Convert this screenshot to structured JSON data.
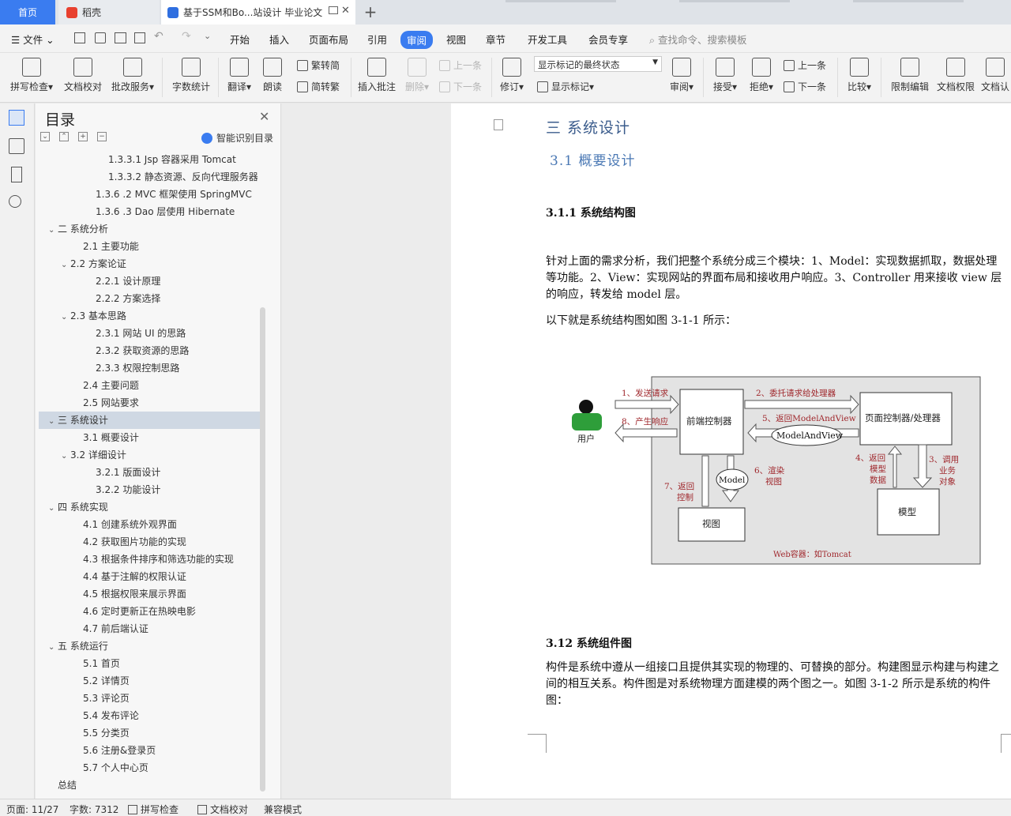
{
  "tabs": {
    "home": "首页",
    "daoke": "稻壳",
    "doc": "基于SSM和Bo...站设计 毕业论文",
    "new_tab": "+"
  },
  "menubar": {
    "file": "文件",
    "items": [
      "开始",
      "插入",
      "页面布局",
      "引用",
      "审阅",
      "视图",
      "章节",
      "开发工具",
      "会员专享"
    ],
    "search": "查找命令、搜索模板"
  },
  "ribbon": {
    "spell_check": "拼写检查",
    "doc_proof": "文档校对",
    "batch_service": "批改服务",
    "word_count": "字数统计",
    "translate": "翻译",
    "read_aloud": "朗读",
    "trad_simp": "繁转简",
    "simp_trad": "简转繁",
    "insert_comment": "插入批注",
    "delete": "删除",
    "prev_comment": "上一条",
    "next_comment": "下一条",
    "revise": "修订",
    "markup_state": "显示标记的最终状态",
    "show_markup": "显示标记",
    "review_pane": "审阅",
    "accept": "接受",
    "reject": "拒绝",
    "prev_change": "上一条",
    "next_change": "下一条",
    "compare": "比较",
    "restrict_edit": "限制编辑",
    "doc_rights": "文档权限",
    "doc_auth": "文档认"
  },
  "toc": {
    "title": "目录",
    "smart": "智能识别目录",
    "items": [
      {
        "text": "1.3.3.1 Jsp 容器采用 Tomcat",
        "indent": 4,
        "chev": ""
      },
      {
        "text": "1.3.3.2 静态资源、反向代理服务器 ...",
        "indent": 4,
        "chev": ""
      },
      {
        "text": "1.3.6 .2 MVC 框架使用 SpringMVC",
        "indent": 3,
        "chev": ""
      },
      {
        "text": "1.3.6 .3 Dao 层使用 Hibernate",
        "indent": 3,
        "chev": ""
      },
      {
        "text": "二 系统分析",
        "indent": 0,
        "chev": "v"
      },
      {
        "text": "2.1 主要功能",
        "indent": 2,
        "chev": ""
      },
      {
        "text": "2.2 方案论证",
        "indent": 1,
        "chev": "v"
      },
      {
        "text": "2.2.1 设计原理",
        "indent": 3,
        "chev": ""
      },
      {
        "text": "2.2.2 方案选择",
        "indent": 3,
        "chev": ""
      },
      {
        "text": "2.3 基本思路",
        "indent": 1,
        "chev": "v"
      },
      {
        "text": "2.3.1 网站 UI 的思路",
        "indent": 3,
        "chev": ""
      },
      {
        "text": "2.3.2 获取资源的思路",
        "indent": 3,
        "chev": ""
      },
      {
        "text": "2.3.3 权限控制思路",
        "indent": 3,
        "chev": ""
      },
      {
        "text": "2.4 主要问题",
        "indent": 2,
        "chev": ""
      },
      {
        "text": "2.5 网站要求",
        "indent": 2,
        "chev": ""
      },
      {
        "text": "三 系统设计",
        "indent": 0,
        "chev": "v",
        "selected": true
      },
      {
        "text": "3.1 概要设计",
        "indent": 2,
        "chev": ""
      },
      {
        "text": "3.2 详细设计",
        "indent": 1,
        "chev": "v"
      },
      {
        "text": "3.2.1 版面设计",
        "indent": 3,
        "chev": ""
      },
      {
        "text": "3.2.2 功能设计",
        "indent": 3,
        "chev": ""
      },
      {
        "text": "四 系统实现",
        "indent": 0,
        "chev": "v"
      },
      {
        "text": "4.1 创建系统外观界面",
        "indent": 2,
        "chev": ""
      },
      {
        "text": "4.2 获取图片功能的实现",
        "indent": 2,
        "chev": ""
      },
      {
        "text": "4.3 根据条件排序和筛选功能的实现",
        "indent": 2,
        "chev": ""
      },
      {
        "text": "4.4 基于注解的权限认证",
        "indent": 2,
        "chev": ""
      },
      {
        "text": "4.5 根据权限来展示界面",
        "indent": 2,
        "chev": ""
      },
      {
        "text": "4.6 定时更新正在热映电影",
        "indent": 2,
        "chev": ""
      },
      {
        "text": "4.7 前后端认证",
        "indent": 2,
        "chev": ""
      },
      {
        "text": "五 系统运行",
        "indent": 0,
        "chev": "v"
      },
      {
        "text": "5.1 首页",
        "indent": 2,
        "chev": ""
      },
      {
        "text": "5.2 详情页",
        "indent": 2,
        "chev": ""
      },
      {
        "text": "5.3 评论页",
        "indent": 2,
        "chev": ""
      },
      {
        "text": "5.4 发布评论",
        "indent": 2,
        "chev": ""
      },
      {
        "text": "5.5 分类页",
        "indent": 2,
        "chev": ""
      },
      {
        "text": "5.6 注册&登录页",
        "indent": 2,
        "chev": ""
      },
      {
        "text": "5.7 个人中心页",
        "indent": 2,
        "chev": ""
      },
      {
        "text": "总结",
        "indent": 0,
        "chev": ""
      }
    ]
  },
  "document": {
    "h1": "三 系统设计",
    "h2": "3.1 概要设计",
    "h311": "3.1.1 系统结构图",
    "p1": "针对上面的需求分析，我们把整个系统分成三个模块：1、Model：实现数据抓取，数据处理等功能。2、View：实现网站的界面布局和接收用户响应。3、Controller 用来接收 view 层的响应，转发给 model 层。",
    "p2": "以下就是系统结构图如图 3-1-1 所示：",
    "h312": "3.12 系统组件图",
    "p3": "构件是系统中遵从一组接口且提供其实现的物理的、可替换的部分。构建图显示构建与构建之间的相互关系。构件图是对系统物理方面建模的两个图之一。如图 3-1-2 所示是系统的构件图："
  },
  "diagram": {
    "user": "用户",
    "front_controller": "前端控制器",
    "page_controller": "页面控制器/处理器",
    "model_and_view": "ModelAndView",
    "model_oval": "Model",
    "view": "视图",
    "model_box": "模型",
    "step1": "1、发送请求",
    "step8": "8、产生响应",
    "step2": "2、委托请求给处理器",
    "step5": "5、返回ModelAndView",
    "step3a": "3、调用",
    "step3b": "业务",
    "step3c": "对象",
    "step4a": "4、返回",
    "step4b": "模型",
    "step4c": "数据",
    "step6a": "6、渲染",
    "step6b": "视图",
    "step7a": "7、返回",
    "step7b": "控制",
    "container": "Web容器：如Tomcat"
  },
  "statusbar": {
    "page": "页面: 11/27",
    "words": "字数: 7312",
    "spell": "拼写检查",
    "proof": "文档校对",
    "compat": "兼容模式"
  },
  "colors": {
    "accent": "#3a7cf0",
    "heading1": "#3b5c8c",
    "heading2": "#4a78b4",
    "diagram_red": "#a0282d",
    "user_green": "#2e9e3a"
  }
}
